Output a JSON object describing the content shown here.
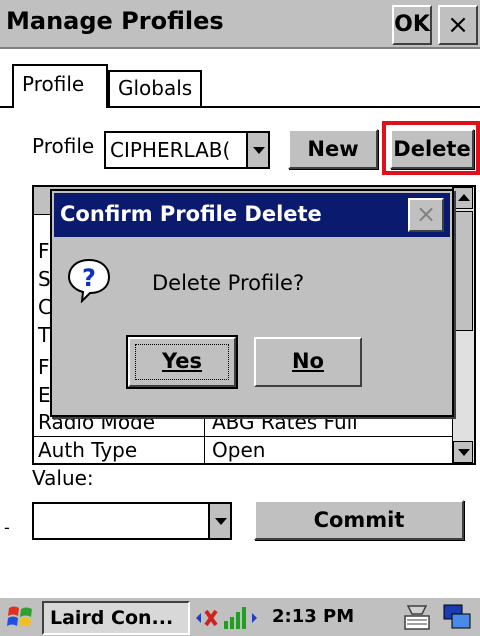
{
  "window": {
    "title": "Manage Profiles",
    "ok_label": "OK",
    "close_label": "×"
  },
  "tabs": [
    {
      "label": "Profile",
      "active": true
    },
    {
      "label": "Globals",
      "active": false
    }
  ],
  "profile_row": {
    "label": "Profile",
    "selected": "CIPHERLAB(",
    "new_label": "New",
    "delete_label": "Delete"
  },
  "list": {
    "visible_rows": [
      {
        "name": "Radio Mode",
        "value": "ABG Rates Full"
      },
      {
        "name": "Auth Type",
        "value": "Open"
      }
    ],
    "partially_visible_left_letters": [
      "F",
      "S",
      "C",
      "T",
      "F",
      "E"
    ]
  },
  "value_row": {
    "label": "Value:",
    "selected": "",
    "commit_label": "Commit"
  },
  "dialog": {
    "title": "Confirm Profile Delete",
    "close_label": "×",
    "message": "Delete Profile?",
    "yes_label": "Yes",
    "no_label": "No",
    "icon": "question-icon"
  },
  "taskbar": {
    "app_label": "Laird Con...",
    "time": "2:13 PM",
    "icons": [
      "start-icon",
      "wireless-icon",
      "signal-icon",
      "keyboard-icon",
      "sip-icon"
    ]
  },
  "colors": {
    "highlight": "#e0101a",
    "dialog_title_bg": "#0a1a6e"
  }
}
